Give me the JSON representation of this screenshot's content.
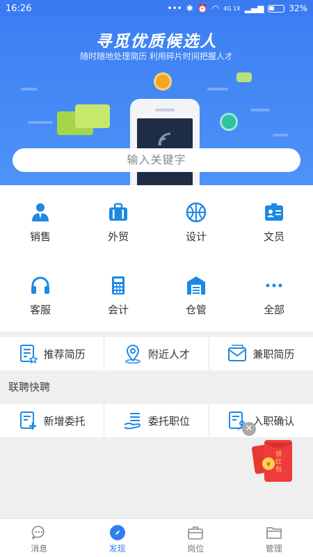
{
  "status_bar": {
    "time": "16:26",
    "network": "4G 1X",
    "battery": "32%"
  },
  "banner": {
    "title": "寻觅优质候选人",
    "subtitle": "随时随地处理简历 利用碎片时间把握人才"
  },
  "search": {
    "placeholder": "输入关键字"
  },
  "categories": [
    {
      "label": "销售",
      "icon": "person-icon"
    },
    {
      "label": "外贸",
      "icon": "briefcase-icon"
    },
    {
      "label": "设计",
      "icon": "ball-icon"
    },
    {
      "label": "文员",
      "icon": "id-card-icon"
    },
    {
      "label": "客服",
      "icon": "headset-icon"
    },
    {
      "label": "会计",
      "icon": "calculator-icon"
    },
    {
      "label": "仓管",
      "icon": "warehouse-icon"
    },
    {
      "label": "全部",
      "icon": "more-dots-icon"
    }
  ],
  "quick_actions": [
    {
      "label": "推荐简历",
      "icon": "resume-star-icon"
    },
    {
      "label": "附近人才",
      "icon": "location-icon"
    },
    {
      "label": "兼职简历",
      "icon": "mail-icon"
    }
  ],
  "section": {
    "title": "联聘快聘"
  },
  "lianpin_actions": [
    {
      "label": "新增委托",
      "icon": "doc-add-icon"
    },
    {
      "label": "委托职位",
      "icon": "hand-list-icon"
    },
    {
      "label": "入职确认",
      "icon": "doc-person-icon"
    }
  ],
  "red_packet": {
    "text": "领红包"
  },
  "tabs": [
    {
      "label": "消息",
      "icon": "chat-icon"
    },
    {
      "label": "发现",
      "icon": "compass-icon"
    },
    {
      "label": "岗位",
      "icon": "briefcase-icon"
    },
    {
      "label": "管理",
      "icon": "folder-icon"
    }
  ],
  "colors": {
    "accent": "#2f7ff0",
    "icon_blue": "#1e88e5",
    "banner": "#3d7ff3",
    "red": "#e53935"
  }
}
